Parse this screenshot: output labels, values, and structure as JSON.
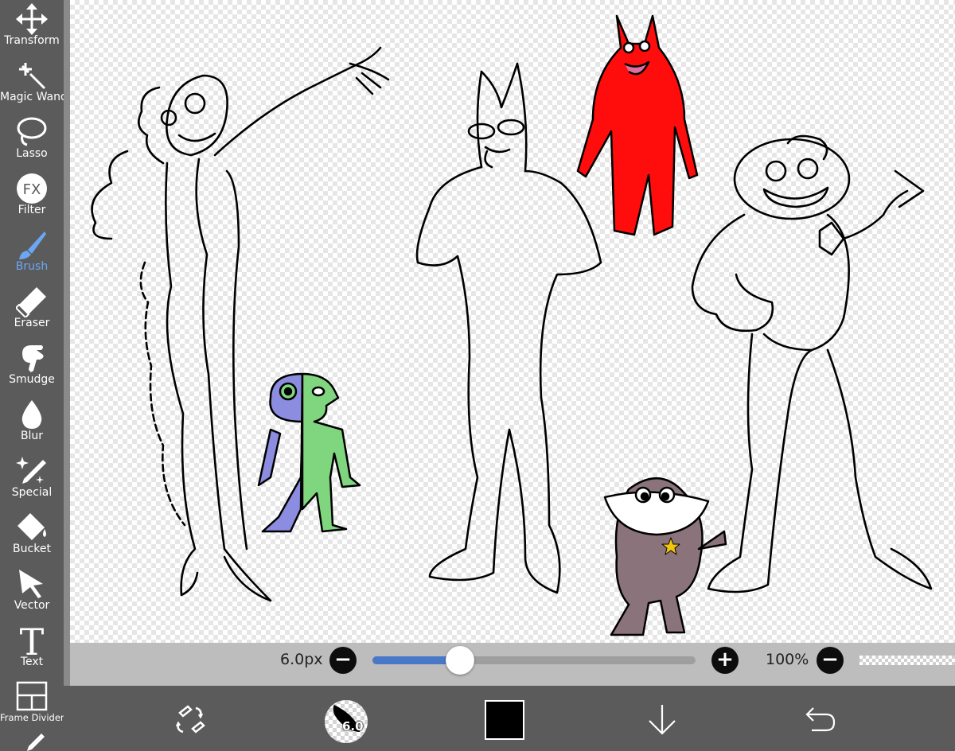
{
  "toolbar": {
    "tools": [
      {
        "label": "Transform",
        "icon": "move-arrows-icon"
      },
      {
        "label": "Magic Wand",
        "icon": "magic-wand-icon"
      },
      {
        "label": "Lasso",
        "icon": "lasso-icon"
      },
      {
        "label": "Filter",
        "icon": "fx-icon",
        "icon_text": "FX"
      },
      {
        "label": "Brush",
        "icon": "brush-icon",
        "active": true
      },
      {
        "label": "Eraser",
        "icon": "eraser-icon"
      },
      {
        "label": "Smudge",
        "icon": "smudge-hand-icon"
      },
      {
        "label": "Blur",
        "icon": "water-drop-icon"
      },
      {
        "label": "Special",
        "icon": "sparkle-pen-icon"
      },
      {
        "label": "Bucket",
        "icon": "bucket-icon"
      },
      {
        "label": "Vector",
        "icon": "arrow-cursor-icon"
      },
      {
        "label": "Text",
        "icon": "text-icon",
        "icon_text": "T"
      },
      {
        "label": "Frame Divider",
        "icon": "frame-divider-icon"
      }
    ],
    "active_color": "#6ba7f5"
  },
  "brush_bar": {
    "size_label": "6.0px",
    "size_fraction": 0.27,
    "minus": "−",
    "plus": "+",
    "zoom_label": "100%",
    "zoom_minus": "−"
  },
  "bottom_bar": {
    "brush_size": "6.0",
    "primary_color": "#000000",
    "icons": [
      "swap-tools-icon",
      "brush-preview",
      "color-swatch",
      "download-arrow-icon",
      "undo-icon"
    ]
  },
  "colors": {
    "accent": "#4a78c8",
    "red_figure": "#ff0d0d",
    "purple_figure": "#8c8ce0",
    "green_figure": "#7fd67f",
    "brown_figure": "#8a737a"
  }
}
